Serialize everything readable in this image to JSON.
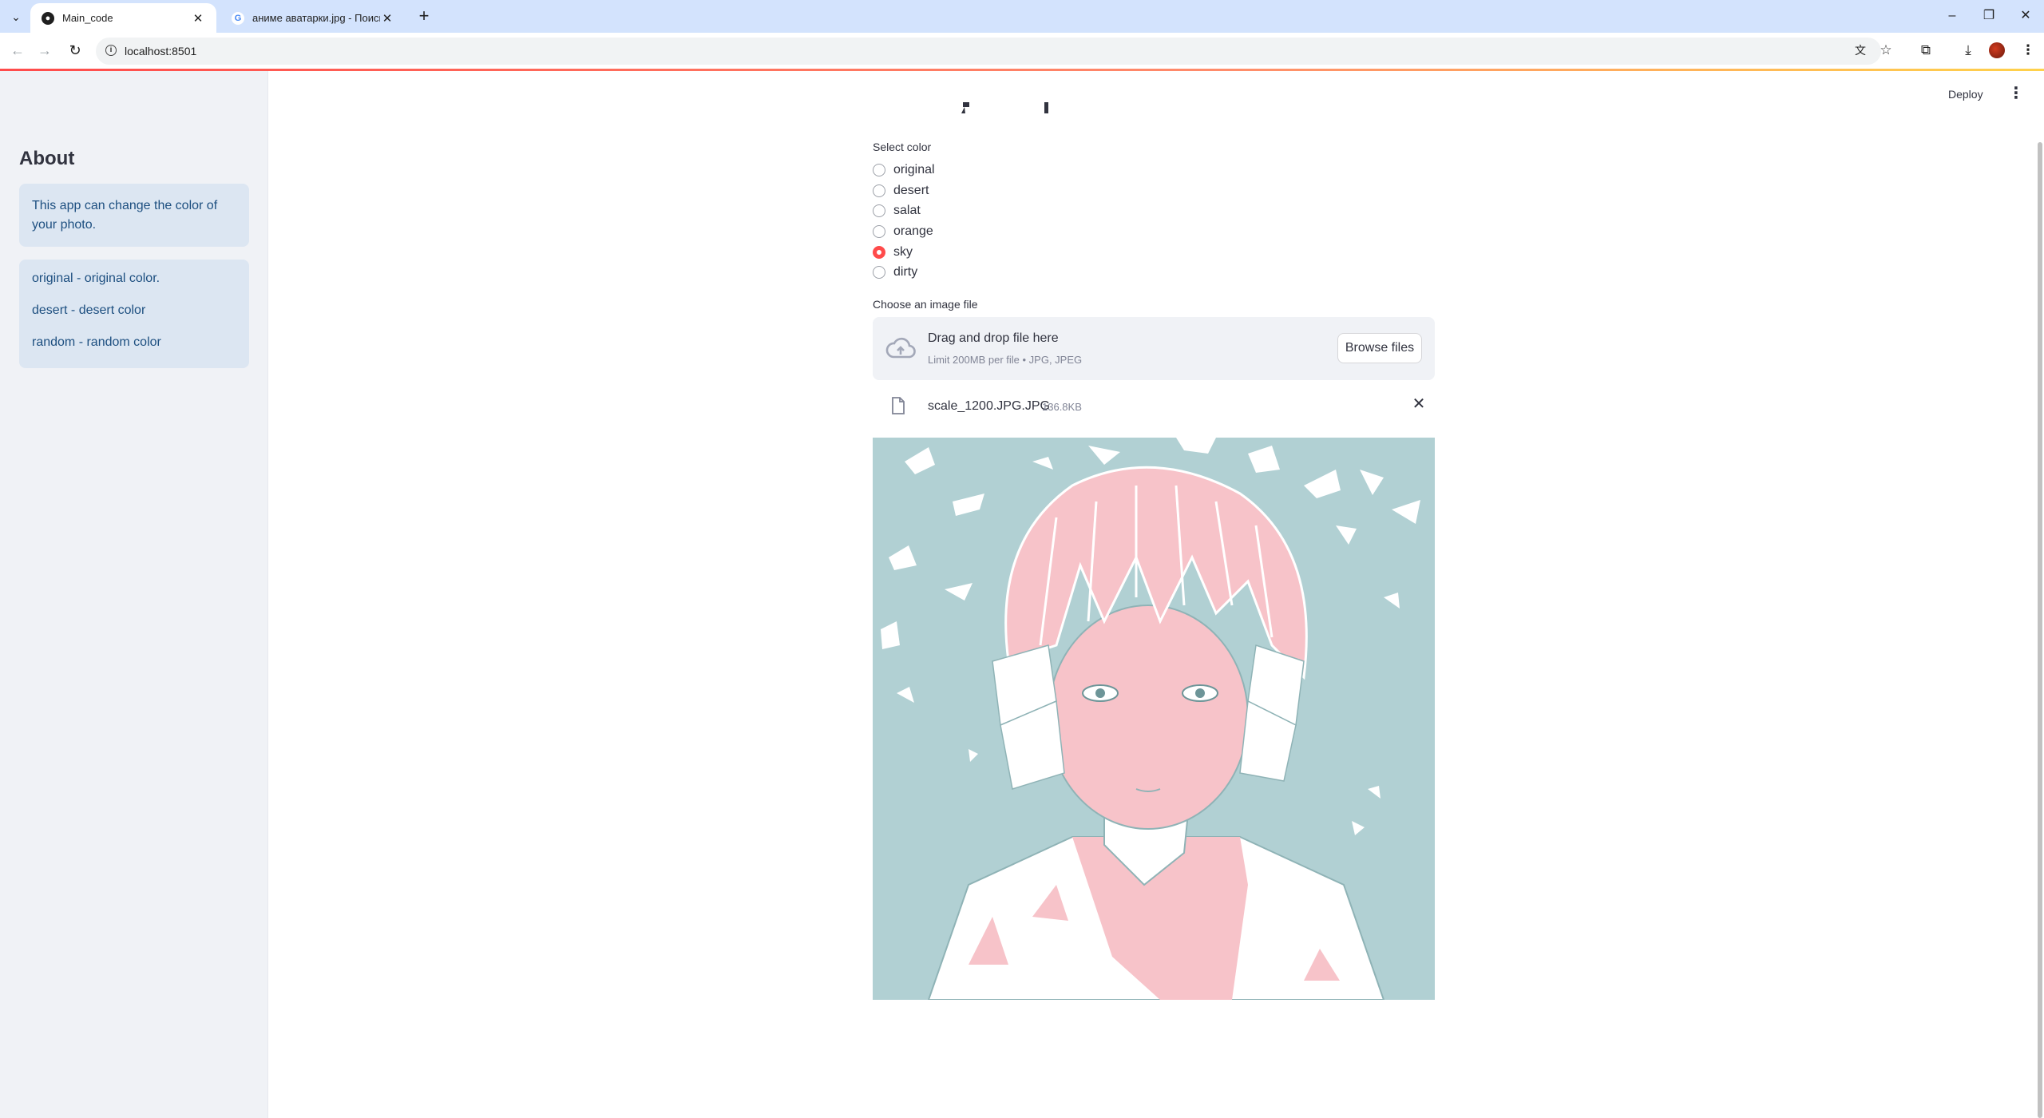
{
  "browser": {
    "tabs": [
      {
        "title": "Main_code",
        "close": "✕",
        "active": true
      },
      {
        "title": "аниме аватарки.jpg - Поиск в",
        "close": "✕",
        "active": false
      }
    ],
    "new_tab": "+",
    "window_controls": [
      "–",
      "❐",
      "✕"
    ],
    "url": "localhost:8501"
  },
  "sidebar": {
    "title": "About",
    "info1": "This app can change the color of your photo.",
    "items": [
      "original - original color.",
      "desert - desert color",
      "random - random color"
    ]
  },
  "header": {
    "deploy_label": "Deploy",
    "menu_glyph": "⋮",
    "title_fragment": ""
  },
  "main": {
    "select_label": "Select color",
    "options": [
      "original",
      "desert",
      "salat",
      "orange",
      "sky",
      "dirty"
    ],
    "selected": "sky",
    "uploader_label": "Choose an image file",
    "drop_text": "Drag and drop file here",
    "limit_text": "Limit 200MB per file • JPG, JPEG",
    "browse_label": "Browse files",
    "file_name": "scale_1200.JPG.JPG",
    "file_size": "136.8KB"
  },
  "colors": {
    "accent": "#ff4b4b",
    "sky_bg": "#b1d0d3",
    "pink": "#f7c3c9",
    "info_bg": "#dce6f2",
    "info_text": "#1d4f80"
  }
}
